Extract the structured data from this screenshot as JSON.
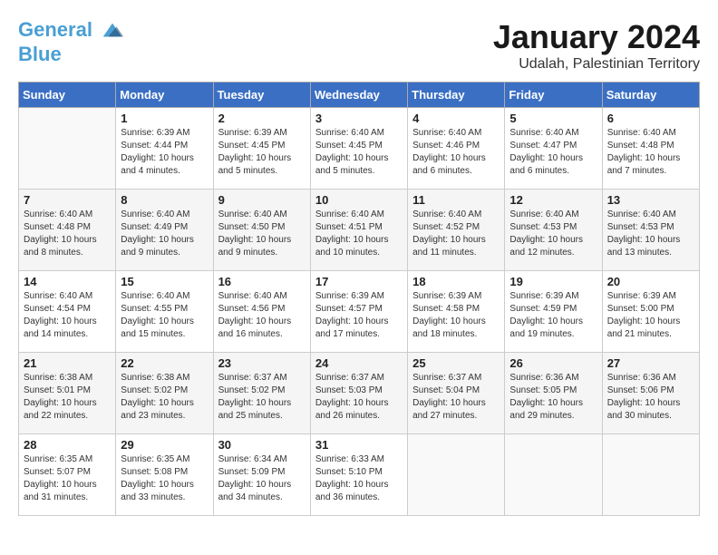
{
  "header": {
    "logo_line1": "General",
    "logo_line2": "Blue",
    "month_title": "January 2024",
    "location": "Udalah, Palestinian Territory"
  },
  "weekdays": [
    "Sunday",
    "Monday",
    "Tuesday",
    "Wednesday",
    "Thursday",
    "Friday",
    "Saturday"
  ],
  "weeks": [
    [
      {
        "day": "",
        "info": ""
      },
      {
        "day": "1",
        "info": "Sunrise: 6:39 AM\nSunset: 4:44 PM\nDaylight: 10 hours\nand 4 minutes."
      },
      {
        "day": "2",
        "info": "Sunrise: 6:39 AM\nSunset: 4:45 PM\nDaylight: 10 hours\nand 5 minutes."
      },
      {
        "day": "3",
        "info": "Sunrise: 6:40 AM\nSunset: 4:45 PM\nDaylight: 10 hours\nand 5 minutes."
      },
      {
        "day": "4",
        "info": "Sunrise: 6:40 AM\nSunset: 4:46 PM\nDaylight: 10 hours\nand 6 minutes."
      },
      {
        "day": "5",
        "info": "Sunrise: 6:40 AM\nSunset: 4:47 PM\nDaylight: 10 hours\nand 6 minutes."
      },
      {
        "day": "6",
        "info": "Sunrise: 6:40 AM\nSunset: 4:48 PM\nDaylight: 10 hours\nand 7 minutes."
      }
    ],
    [
      {
        "day": "7",
        "info": "Sunrise: 6:40 AM\nSunset: 4:48 PM\nDaylight: 10 hours\nand 8 minutes."
      },
      {
        "day": "8",
        "info": "Sunrise: 6:40 AM\nSunset: 4:49 PM\nDaylight: 10 hours\nand 9 minutes."
      },
      {
        "day": "9",
        "info": "Sunrise: 6:40 AM\nSunset: 4:50 PM\nDaylight: 10 hours\nand 9 minutes."
      },
      {
        "day": "10",
        "info": "Sunrise: 6:40 AM\nSunset: 4:51 PM\nDaylight: 10 hours\nand 10 minutes."
      },
      {
        "day": "11",
        "info": "Sunrise: 6:40 AM\nSunset: 4:52 PM\nDaylight: 10 hours\nand 11 minutes."
      },
      {
        "day": "12",
        "info": "Sunrise: 6:40 AM\nSunset: 4:53 PM\nDaylight: 10 hours\nand 12 minutes."
      },
      {
        "day": "13",
        "info": "Sunrise: 6:40 AM\nSunset: 4:53 PM\nDaylight: 10 hours\nand 13 minutes."
      }
    ],
    [
      {
        "day": "14",
        "info": "Sunrise: 6:40 AM\nSunset: 4:54 PM\nDaylight: 10 hours\nand 14 minutes."
      },
      {
        "day": "15",
        "info": "Sunrise: 6:40 AM\nSunset: 4:55 PM\nDaylight: 10 hours\nand 15 minutes."
      },
      {
        "day": "16",
        "info": "Sunrise: 6:40 AM\nSunset: 4:56 PM\nDaylight: 10 hours\nand 16 minutes."
      },
      {
        "day": "17",
        "info": "Sunrise: 6:39 AM\nSunset: 4:57 PM\nDaylight: 10 hours\nand 17 minutes."
      },
      {
        "day": "18",
        "info": "Sunrise: 6:39 AM\nSunset: 4:58 PM\nDaylight: 10 hours\nand 18 minutes."
      },
      {
        "day": "19",
        "info": "Sunrise: 6:39 AM\nSunset: 4:59 PM\nDaylight: 10 hours\nand 19 minutes."
      },
      {
        "day": "20",
        "info": "Sunrise: 6:39 AM\nSunset: 5:00 PM\nDaylight: 10 hours\nand 21 minutes."
      }
    ],
    [
      {
        "day": "21",
        "info": "Sunrise: 6:38 AM\nSunset: 5:01 PM\nDaylight: 10 hours\nand 22 minutes."
      },
      {
        "day": "22",
        "info": "Sunrise: 6:38 AM\nSunset: 5:02 PM\nDaylight: 10 hours\nand 23 minutes."
      },
      {
        "day": "23",
        "info": "Sunrise: 6:37 AM\nSunset: 5:02 PM\nDaylight: 10 hours\nand 25 minutes."
      },
      {
        "day": "24",
        "info": "Sunrise: 6:37 AM\nSunset: 5:03 PM\nDaylight: 10 hours\nand 26 minutes."
      },
      {
        "day": "25",
        "info": "Sunrise: 6:37 AM\nSunset: 5:04 PM\nDaylight: 10 hours\nand 27 minutes."
      },
      {
        "day": "26",
        "info": "Sunrise: 6:36 AM\nSunset: 5:05 PM\nDaylight: 10 hours\nand 29 minutes."
      },
      {
        "day": "27",
        "info": "Sunrise: 6:36 AM\nSunset: 5:06 PM\nDaylight: 10 hours\nand 30 minutes."
      }
    ],
    [
      {
        "day": "28",
        "info": "Sunrise: 6:35 AM\nSunset: 5:07 PM\nDaylight: 10 hours\nand 31 minutes."
      },
      {
        "day": "29",
        "info": "Sunrise: 6:35 AM\nSunset: 5:08 PM\nDaylight: 10 hours\nand 33 minutes."
      },
      {
        "day": "30",
        "info": "Sunrise: 6:34 AM\nSunset: 5:09 PM\nDaylight: 10 hours\nand 34 minutes."
      },
      {
        "day": "31",
        "info": "Sunrise: 6:33 AM\nSunset: 5:10 PM\nDaylight: 10 hours\nand 36 minutes."
      },
      {
        "day": "",
        "info": ""
      },
      {
        "day": "",
        "info": ""
      },
      {
        "day": "",
        "info": ""
      }
    ]
  ]
}
